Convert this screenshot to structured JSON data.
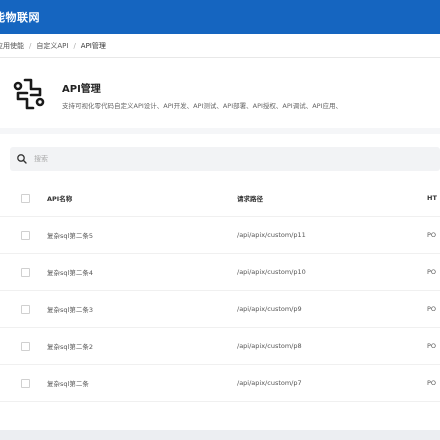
{
  "app": {
    "title": "能物联网"
  },
  "breadcrumb": {
    "items": [
      "应用使能",
      "自定义API",
      "API管理"
    ]
  },
  "header": {
    "title": "API管理",
    "description": "支持可视化零代码自定义API设计、API开发、API测试、API部署、API授权、API调试、API应用、"
  },
  "search": {
    "placeholder": "搜索"
  },
  "table": {
    "columns": [
      "API名称",
      "请求路径",
      "HT"
    ],
    "rows": [
      {
        "name": "复杂sql第二条5",
        "path": "/api/apix/custom/p11",
        "method": "PO"
      },
      {
        "name": "复杂sql第二条4",
        "path": "/api/apix/custom/p10",
        "method": "PO"
      },
      {
        "name": "复杂sql第二条3",
        "path": "/api/apix/custom/p9",
        "method": "PO"
      },
      {
        "name": "复杂sql第二条2",
        "path": "/api/apix/custom/p8",
        "method": "PO"
      },
      {
        "name": "复杂sql第二条",
        "path": "/api/apix/custom/p7",
        "method": "PO"
      }
    ]
  },
  "colors": {
    "topbar": "#1565c0",
    "logo": "#1a1a1a"
  },
  "icons": {
    "logo": "api-logo-icon",
    "search": "search-icon"
  }
}
